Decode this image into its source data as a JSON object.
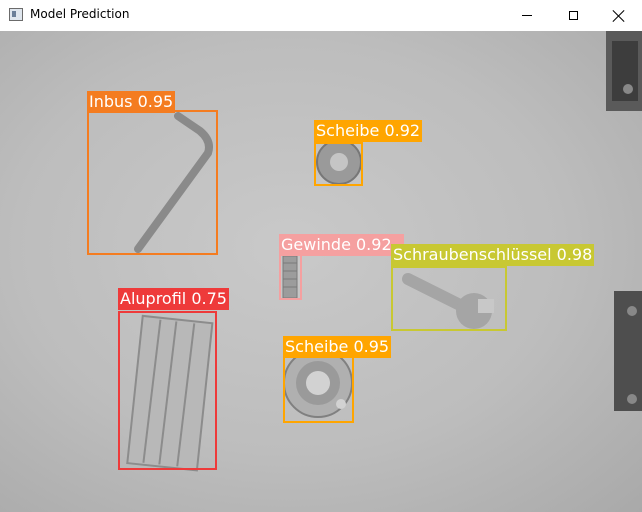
{
  "window": {
    "title": "Model Prediction"
  },
  "controls": {
    "minimize_icon": "minimize-icon",
    "maximize_icon": "maximize-icon",
    "close_icon": "close-icon"
  },
  "detections": [
    {
      "label": "Inbus 0.95",
      "color": "#f47c20"
    },
    {
      "label": "Scheibe 0.92",
      "color": "#ffa500"
    },
    {
      "label": "Gewinde 0.92",
      "color": "#f5a0a0"
    },
    {
      "label": "Schraubenschlüssel 0.98",
      "color": "#c8c832"
    },
    {
      "label": "Aluprofil 0.75",
      "color": "#ee3a3a"
    },
    {
      "label": "Scheibe 0.95",
      "color": "#ffa500"
    }
  ]
}
